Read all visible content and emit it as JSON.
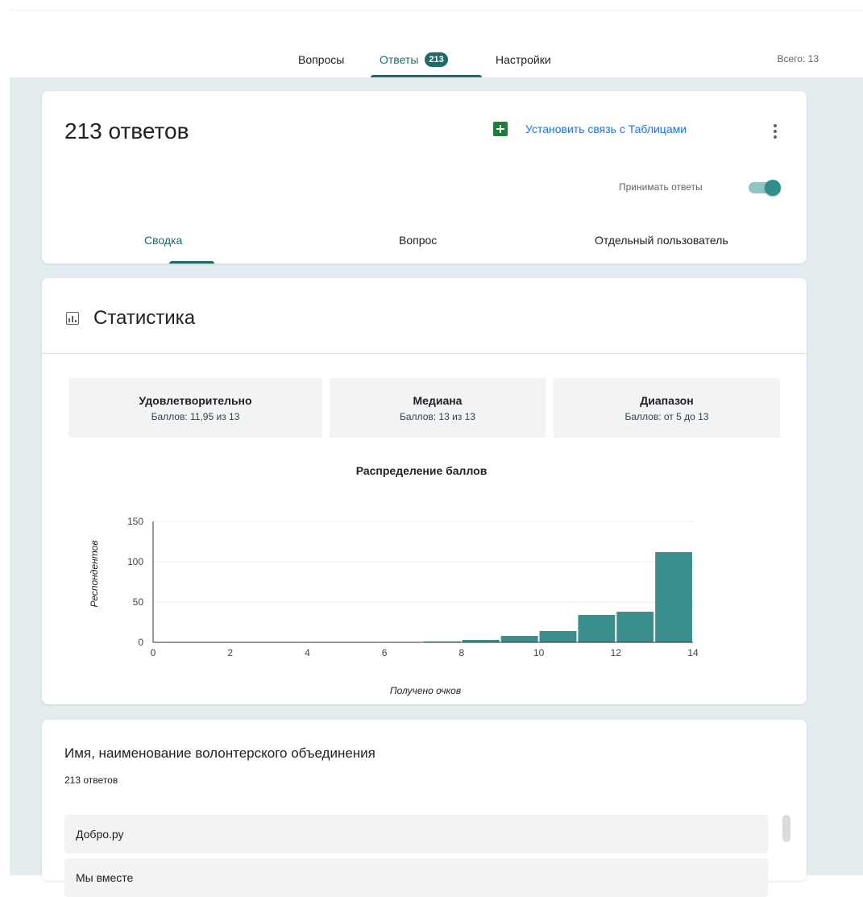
{
  "topnav": {
    "tabs": [
      {
        "label": "Вопросы"
      },
      {
        "label": "Ответы",
        "badge": "213"
      },
      {
        "label": "Настройки"
      }
    ],
    "total": "Всего: 13"
  },
  "summary_card": {
    "title": "213 ответов",
    "sheets_link": "Установить связь с Таблицами",
    "accept_label": "Принимать ответы",
    "accept_on": true,
    "subtabs": [
      {
        "label": "Сводка"
      },
      {
        "label": "Вопрос"
      },
      {
        "label": "Отдельный пользователь"
      }
    ]
  },
  "stats": {
    "title": "Статистика",
    "boxes": [
      {
        "title": "Удовлетворительно",
        "value": "Баллов: 11,95 из 13"
      },
      {
        "title": "Медиана",
        "value": "Баллов: 13 из 13"
      },
      {
        "title": "Диапазон",
        "value": "Баллов: от 5 до 13"
      }
    ]
  },
  "chart_data": {
    "type": "bar",
    "title": "Распределение баллов",
    "xlabel": "Получено очков",
    "ylabel": "Респондентов",
    "xlim": [
      0,
      14
    ],
    "ylim": [
      0,
      150
    ],
    "xticks": [
      "0",
      "2",
      "4",
      "6",
      "8",
      "10",
      "12",
      "14"
    ],
    "yticks": [
      "0",
      "50",
      "100",
      "150"
    ],
    "bins": [
      {
        "x0": 5,
        "x1": 6,
        "value": 0.5
      },
      {
        "x0": 6,
        "x1": 7,
        "value": 0.5
      },
      {
        "x0": 7,
        "x1": 8,
        "value": 1
      },
      {
        "x0": 8,
        "x1": 9,
        "value": 3
      },
      {
        "x0": 9,
        "x1": 10,
        "value": 8
      },
      {
        "x0": 10,
        "x1": 11,
        "value": 14
      },
      {
        "x0": 11,
        "x1": 12,
        "value": 34
      },
      {
        "x0": 12,
        "x1": 13,
        "value": 38
      },
      {
        "x0": 13,
        "x1": 14,
        "value": 112
      }
    ],
    "bar_color": "#3b8f8c",
    "grid": true
  },
  "question": {
    "title": "Имя, наименование волонтерского объединения",
    "count": "213 ответов",
    "answers": [
      "Добро.ру",
      "Мы вместе"
    ]
  }
}
